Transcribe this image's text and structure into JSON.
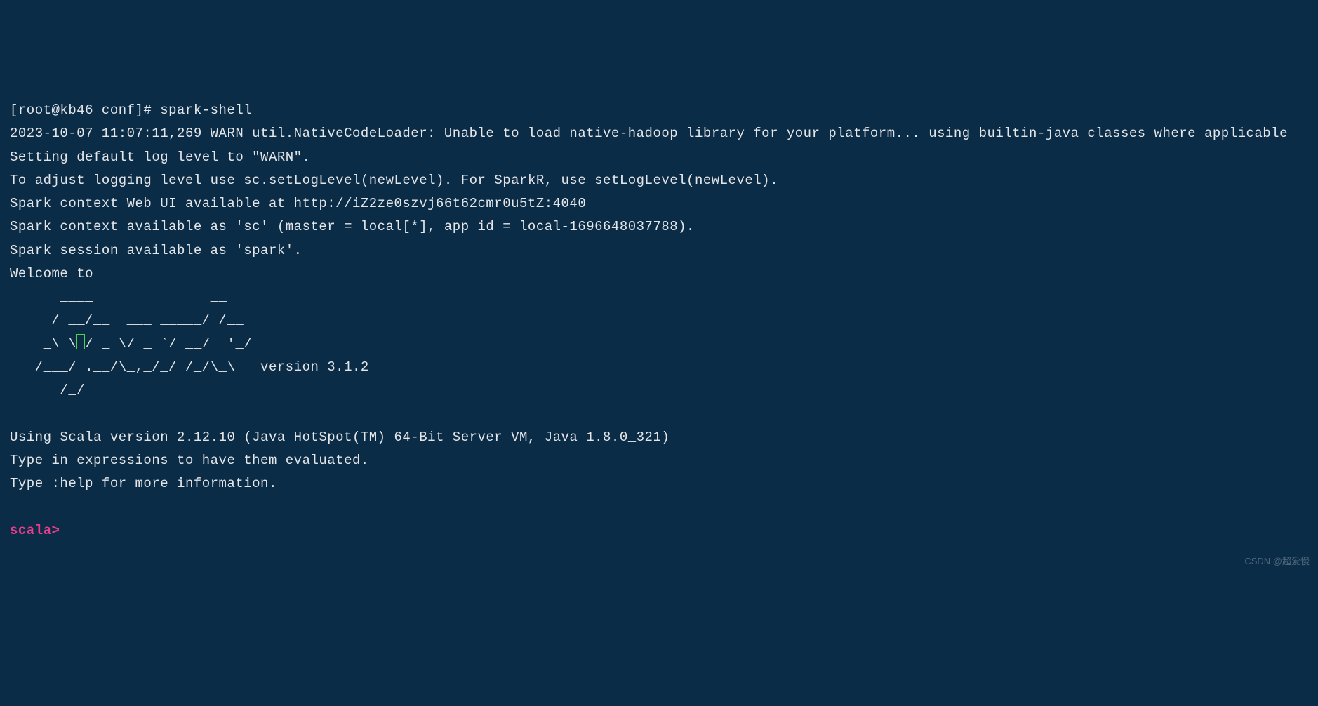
{
  "terminal": {
    "prompt_line": "[root@kb46 conf]# spark-shell",
    "warn_line": "2023-10-07 11:07:11,269 WARN util.NativeCodeLoader: Unable to load native-hadoop library for your platform... using builtin-java classes where applicable",
    "log_level_line": "Setting default log level to \"WARN\".",
    "adjust_log_line": "To adjust logging level use sc.setLogLevel(newLevel). For SparkR, use setLogLevel(newLevel).",
    "webui_line": "Spark context Web UI available at http://iZ2ze0szvj66t62cmr0u5tZ:4040",
    "sc_line": "Spark context available as 'sc' (master = local[*], app id = local-1696648037788).",
    "session_line": "Spark session available as 'spark'.",
    "welcome_line": "Welcome to",
    "ascii_art": {
      "l1": "      ____              __",
      "l2": "     / __/__  ___ _____/ /__",
      "l3_a": "    _\\ \\",
      "l3_b": "/ _ \\/ _ `/ __/  '_/",
      "l4": "   /___/ .__/\\_,_/_/ /_/\\_\\   version 3.1.2",
      "l5": "      /_/"
    },
    "scala_version_line": "Using Scala version 2.12.10 (Java HotSpot(TM) 64-Bit Server VM, Java 1.8.0_321)",
    "type_expr_line": "Type in expressions to have them evaluated.",
    "help_line": "Type :help for more information.",
    "scala_prompt": "scala> "
  },
  "watermark": "CSDN @超爱慢"
}
